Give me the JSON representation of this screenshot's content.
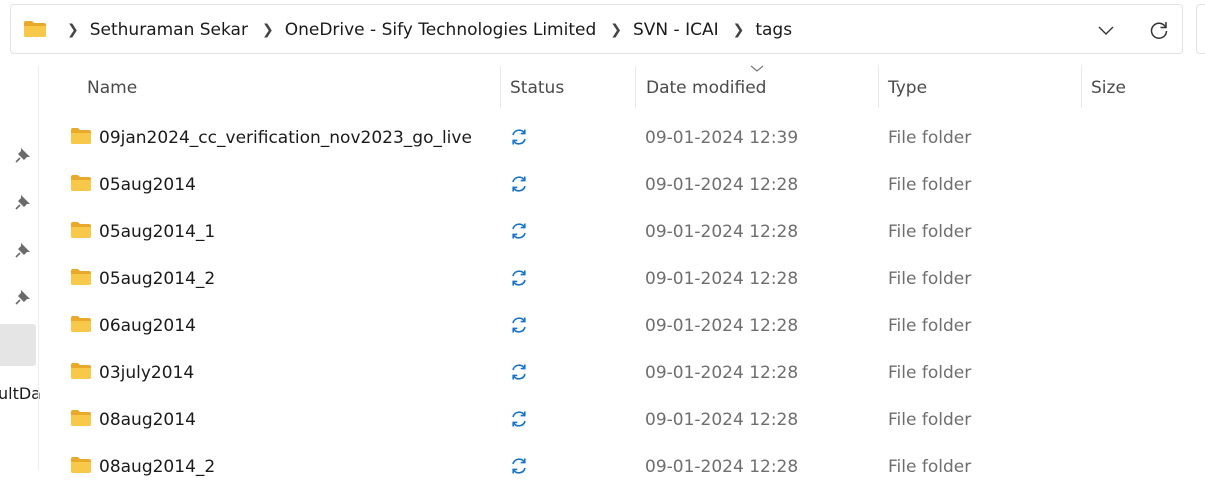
{
  "address_bar": {
    "breadcrumbs": [
      "Sethuraman Sekar",
      "OneDrive - Sify Technologies Limited",
      "SVN - ICAI",
      "tags"
    ]
  },
  "nav": {
    "partial_label": "ultDa"
  },
  "columns": {
    "name": "Name",
    "status": "Status",
    "date_modified": "Date modified",
    "type": "Type",
    "size": "Size"
  },
  "rows": [
    {
      "name": "09jan2024_cc_verification_nov2023_go_live",
      "date": "09-01-2024 12:39",
      "type": "File folder",
      "status": "sync-icon"
    },
    {
      "name": "05aug2014",
      "date": "09-01-2024 12:28",
      "type": "File folder",
      "status": "sync-icon"
    },
    {
      "name": "05aug2014_1",
      "date": "09-01-2024 12:28",
      "type": "File folder",
      "status": "sync-icon"
    },
    {
      "name": "05aug2014_2",
      "date": "09-01-2024 12:28",
      "type": "File folder",
      "status": "sync-icon"
    },
    {
      "name": "06aug2014",
      "date": "09-01-2024 12:28",
      "type": "File folder",
      "status": "sync-icon"
    },
    {
      "name": "03july2014",
      "date": "09-01-2024 12:28",
      "type": "File folder",
      "status": "sync-icon"
    },
    {
      "name": "08aug2014",
      "date": "09-01-2024 12:28",
      "type": "File folder",
      "status": "sync-icon"
    },
    {
      "name": "08aug2014_2",
      "date": "09-01-2024 12:28",
      "type": "File folder",
      "status": "sync-icon"
    }
  ],
  "colors": {
    "folder_fill": "#f8c84a",
    "folder_tab": "#e9a92b",
    "sync_blue": "#1a73c8",
    "muted_text": "#6e6e6e"
  }
}
